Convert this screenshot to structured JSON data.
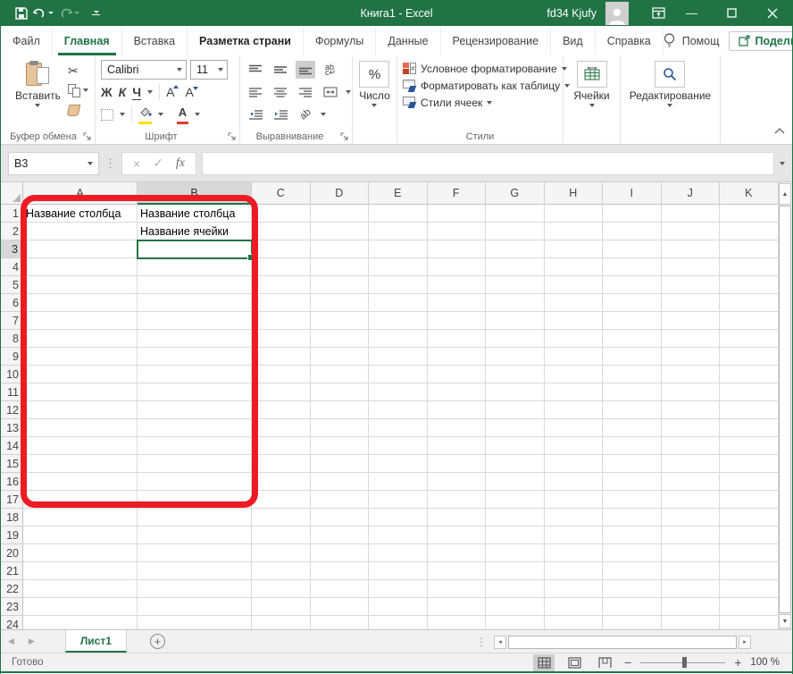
{
  "titlebar": {
    "title": "Книга1 - Excel",
    "user": "fd34 Kjufy"
  },
  "tabs": [
    {
      "label": "Файл"
    },
    {
      "label": "Главная"
    },
    {
      "label": "Вставка"
    },
    {
      "label": "Разметка страни"
    },
    {
      "label": "Формулы"
    },
    {
      "label": "Данные"
    },
    {
      "label": "Рецензирование"
    },
    {
      "label": "Вид"
    },
    {
      "label": "Справка"
    }
  ],
  "help_label": "Помощ",
  "share_label": "Поделиться",
  "ribbon": {
    "clipboard": {
      "label": "Буфер обмена",
      "paste": "Вставить"
    },
    "font": {
      "label": "Шрифт",
      "family": "Calibri",
      "size": "11",
      "bold": "Ж",
      "italic": "К",
      "underline": "Ч",
      "grow": "А",
      "shrink": "А",
      "color_letter": "А"
    },
    "alignment": {
      "label": "Выравнивание",
      "wrap_top": "ab",
      "wrap_bottom": "c",
      "orient": "ab"
    },
    "number": {
      "label": "Число",
      "percent": "%"
    },
    "styles": {
      "label": "Стили",
      "conditional": "Условное форматирование",
      "format_table": "Форматировать как таблицу",
      "cell_styles": "Стили ячеек"
    },
    "cells": {
      "label": "Ячейки"
    },
    "editing": {
      "label": "Редактирование"
    }
  },
  "formula_bar": {
    "name_box": "B3",
    "cancel": "×",
    "confirm": "✓",
    "fx": "fx",
    "value": ""
  },
  "grid": {
    "columns": [
      "A",
      "B",
      "C",
      "D",
      "E",
      "F",
      "G",
      "H",
      "I",
      "J",
      "K"
    ],
    "row_count": 24,
    "cells": [
      {
        "ref": "A1",
        "text": "Название столбца"
      },
      {
        "ref": "B1",
        "text": "Название столбца"
      },
      {
        "ref": "B2",
        "text": "Название ячейки"
      }
    ],
    "selected_cell": "B3",
    "selected_column": "B",
    "selected_row": 3
  },
  "sheet_bar": {
    "sheet": "Лист1",
    "nav_left": "◀",
    "nav_right": "▶",
    "add": "+",
    "dots": "⋮"
  },
  "status_bar": {
    "status": "Готово",
    "zoom_out": "−",
    "zoom_in": "+",
    "zoom": "100 %"
  },
  "icons": {
    "scissors": "✂",
    "formula_dots": "⋮",
    "vscroll_up": "▲",
    "vscroll_down": "▼",
    "hscroll_left": "◂",
    "hscroll_right": "▸",
    "minimize": "—"
  },
  "colors": {
    "accent": "#217346",
    "annotation": "#ec1c24",
    "highlight_yellow": "#ffe100",
    "font_red": "#e23b2e"
  }
}
